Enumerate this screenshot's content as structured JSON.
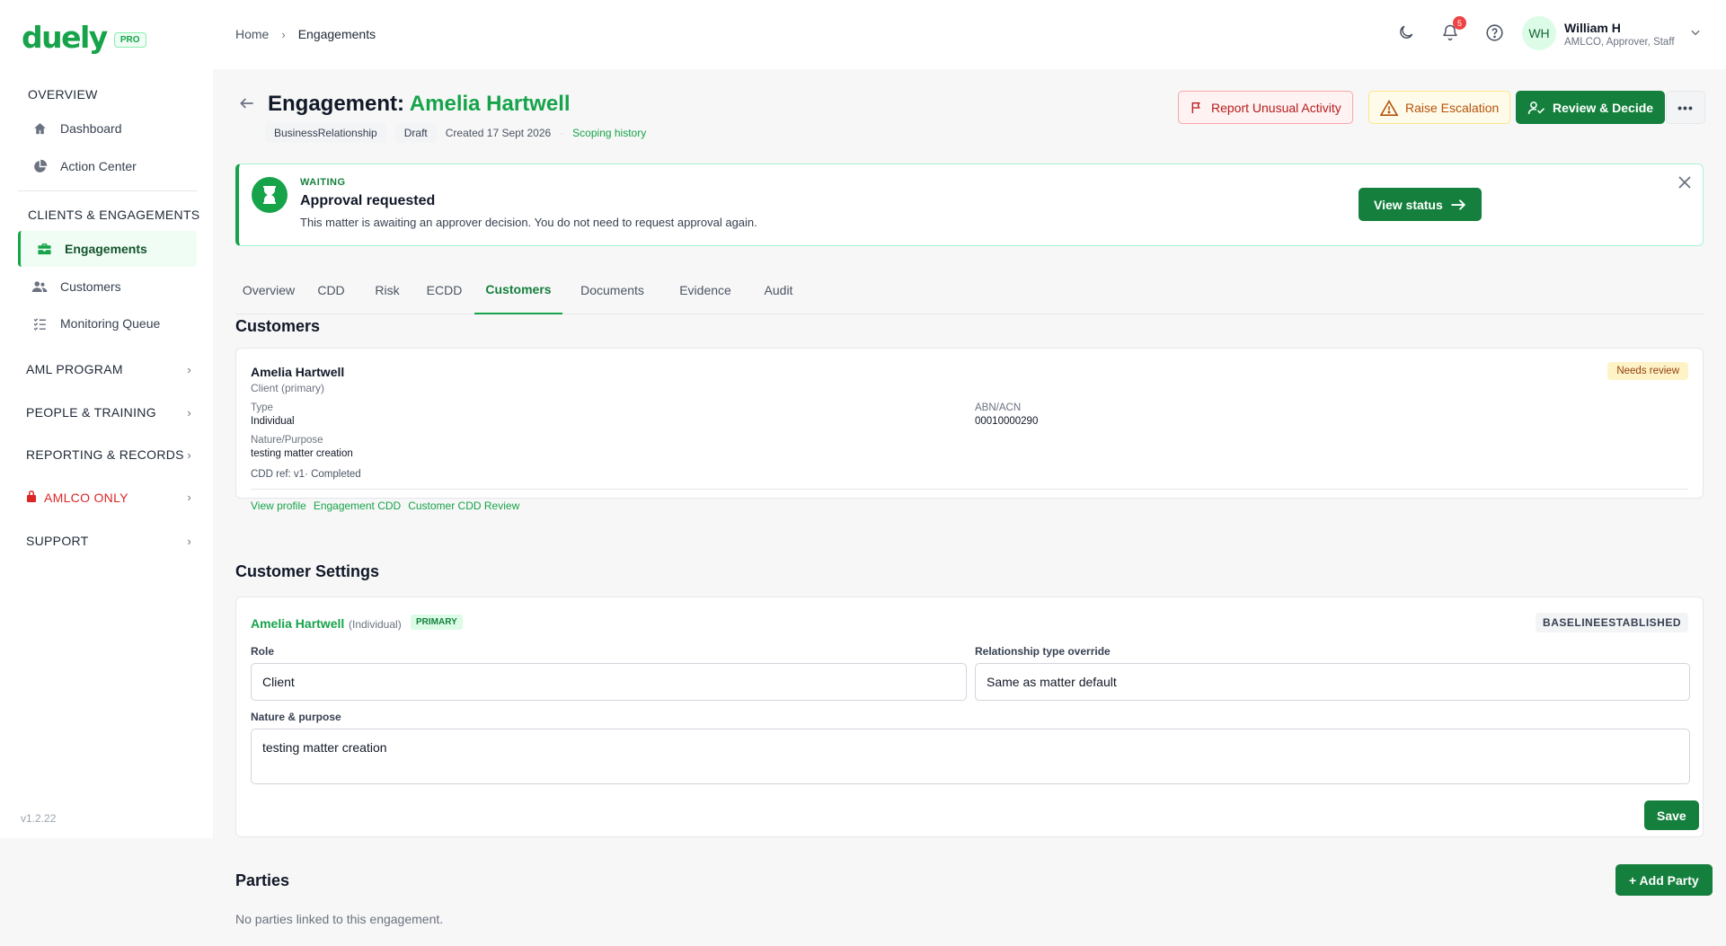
{
  "brand": {
    "name": "duely",
    "badge": "PRO"
  },
  "sidebar": {
    "overview_heading": "OVERVIEW",
    "overview_items": [
      {
        "label": "Dashboard",
        "icon": "home-icon"
      },
      {
        "label": "Action Center",
        "icon": "pie-chart-icon"
      }
    ],
    "clients_heading": "CLIENTS & ENGAGEMENTS",
    "clients_items": [
      {
        "label": "Engagements",
        "icon": "briefcase-icon",
        "active": true
      },
      {
        "label": "Customers",
        "icon": "users-icon"
      },
      {
        "label": "Monitoring Queue",
        "icon": "list-check-icon"
      }
    ],
    "groups": [
      {
        "label": "AML PROGRAM"
      },
      {
        "label": "PEOPLE & TRAINING"
      },
      {
        "label": "REPORTING & RECORDS"
      },
      {
        "label": "AMLCO ONLY",
        "icon": "lock-icon"
      },
      {
        "label": "SUPPORT"
      }
    ],
    "version": "v1.2.22"
  },
  "topbar": {
    "breadcrumb": [
      "Home",
      "Engagements"
    ],
    "notification_count": "5",
    "user": {
      "initials": "WH",
      "name": "William H",
      "role": "AMLCO, Approver, Staff"
    }
  },
  "header": {
    "title_prefix": "Engagement: ",
    "title_name": "Amelia Hartwell",
    "type_chip": "BusinessRelationship",
    "status_chip": "Draft",
    "created": "Created 17 Sept 2026",
    "separator": "·",
    "history_link": "Scoping history",
    "actions": {
      "report": "Report Unusual Activity",
      "escalate": "Raise Escalation",
      "review": "Review & Decide",
      "more": "•••"
    }
  },
  "banner": {
    "tag": "WAITING",
    "title": "Approval requested",
    "text": "This matter is awaiting an approver decision. You do not need to request approval again.",
    "button": "View status"
  },
  "tabs": [
    "Overview",
    "CDD",
    "Risk",
    "ECDD",
    "Customers",
    "Documents",
    "Evidence",
    "Audit"
  ],
  "active_tab": "Customers",
  "customers": {
    "title": "Customers",
    "card": {
      "name": "Amelia Hartwell",
      "role": "Client (primary)",
      "status": "Needs review",
      "type_label": "Type",
      "type_value": "Individual",
      "abn_label": "ABN/ACN",
      "abn_value": "00010000290",
      "nature_label": "Nature/Purpose",
      "nature_value": "testing matter creation",
      "cdd_ref": "CDD ref: v1· Completed",
      "links": [
        "View profile",
        "Engagement CDD",
        "Customer CDD Review"
      ]
    }
  },
  "settings": {
    "title": "Customer Settings",
    "name": "Amelia Hartwell",
    "type": "(Individual)",
    "primary": "PRIMARY",
    "baseline": "BASELINEESTABLISHED",
    "role_label": "Role",
    "role_value": "Client",
    "relationship_label": "Relationship type override",
    "relationship_value": "Same as matter default",
    "nature_label": "Nature & purpose",
    "nature_value": "testing matter creation",
    "save": "Save"
  },
  "parties": {
    "title": "Parties",
    "add_button": "+ Add Party",
    "empty": "No parties linked to this engagement."
  },
  "colors": {
    "accent": "#16a34a",
    "danger": "#dc2626",
    "warning": "#b45309"
  }
}
